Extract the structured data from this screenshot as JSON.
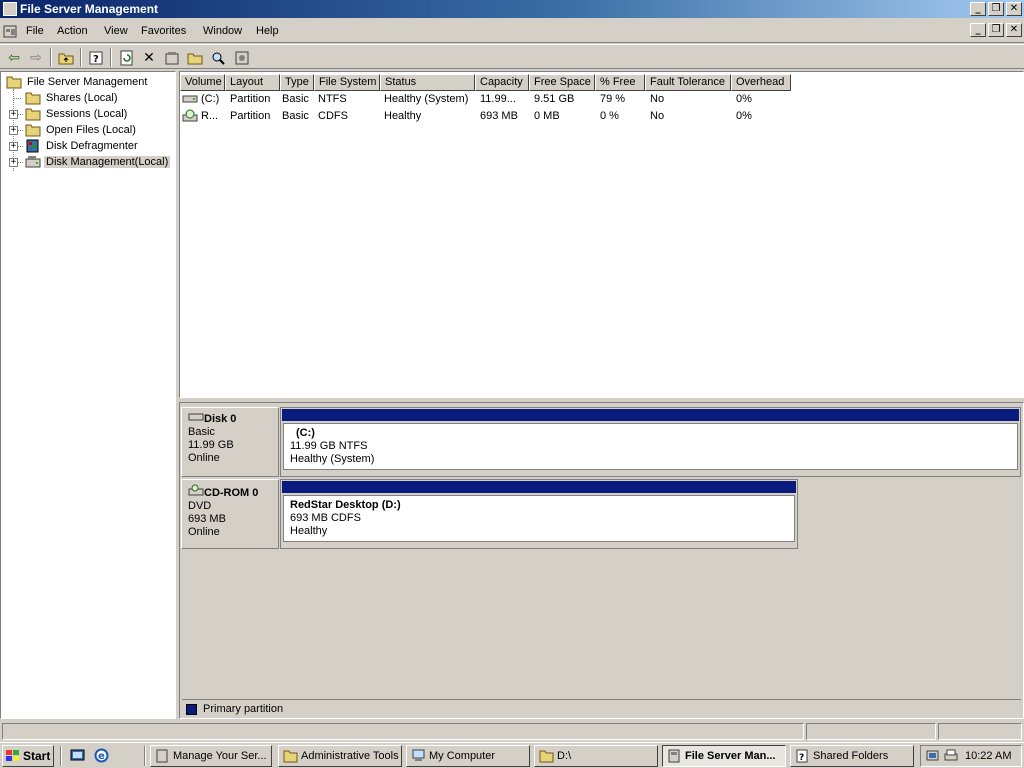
{
  "window": {
    "title": "File Server Management"
  },
  "menu": [
    "File",
    "Action",
    "View",
    "Favorites",
    "Window",
    "Help"
  ],
  "tree": [
    {
      "label": "File Server Management"
    },
    {
      "label": "Shares (Local)"
    },
    {
      "label": "Sessions (Local)"
    },
    {
      "label": "Open Files (Local)"
    },
    {
      "label": "Disk Defragmenter"
    },
    {
      "label": "Disk Management(Local)"
    }
  ],
  "volumes": {
    "columns": [
      "Volume",
      "Layout",
      "Type",
      "File System",
      "Status",
      "Capacity",
      "Free Space",
      "% Free",
      "Fault Tolerance",
      "Overhead"
    ],
    "rows": [
      [
        "(C:)",
        "Partition",
        "Basic",
        "NTFS",
        "Healthy (System)",
        "11.99...",
        "9.51 GB",
        "79 %",
        "No",
        "0%"
      ],
      [
        "R...",
        "Partition",
        "Basic",
        "CDFS",
        "Healthy",
        "693 MB",
        "0 MB",
        "0 %",
        "No",
        "0%"
      ]
    ]
  },
  "disks": [
    {
      "name": "Disk 0",
      "type": "Basic",
      "size": "11.99 GB",
      "status": "Online",
      "volume": {
        "name": "(C:)",
        "detail": "11.99 GB NTFS",
        "status": "Healthy (System)"
      }
    },
    {
      "name": "CD-ROM 0",
      "type": "DVD",
      "size": "693 MB",
      "status": "Online",
      "volume": {
        "name": "RedStar Desktop  (D:)",
        "detail": "693 MB CDFS",
        "status": "Healthy"
      }
    }
  ],
  "legend": {
    "label": "Primary partition",
    "color": "#0a1c7e"
  },
  "taskbar": {
    "start": "Start",
    "buttons": [
      "Manage Your Ser...",
      "Administrative Tools",
      "My Computer",
      "D:\\",
      "File Server Man...",
      "Shared Folders"
    ],
    "clock": "10:22 AM"
  }
}
